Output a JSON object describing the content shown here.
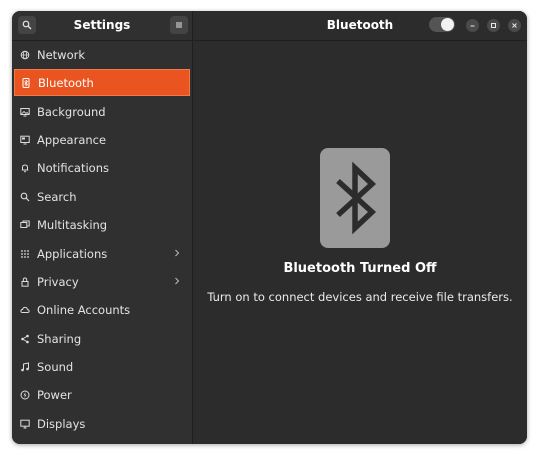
{
  "sidebar": {
    "title": "Settings",
    "items": [
      {
        "label": "Network",
        "icon": "network-icon"
      },
      {
        "label": "Bluetooth",
        "icon": "bluetooth-icon",
        "selected": true
      },
      {
        "label": "Background",
        "icon": "background-icon"
      },
      {
        "label": "Appearance",
        "icon": "appearance-icon"
      },
      {
        "label": "Notifications",
        "icon": "bell-icon"
      },
      {
        "label": "Search",
        "icon": "search-icon"
      },
      {
        "label": "Multitasking",
        "icon": "multitasking-icon"
      },
      {
        "label": "Applications",
        "icon": "applications-icon",
        "has_arrow": true
      },
      {
        "label": "Privacy",
        "icon": "lock-icon",
        "has_arrow": true
      },
      {
        "label": "Online Accounts",
        "icon": "cloud-icon"
      },
      {
        "label": "Sharing",
        "icon": "sharing-icon"
      },
      {
        "label": "Sound",
        "icon": "music-note-icon"
      },
      {
        "label": "Power",
        "icon": "power-icon"
      },
      {
        "label": "Displays",
        "icon": "display-icon"
      }
    ]
  },
  "header": {
    "title": "Bluetooth",
    "toggle_on": false
  },
  "main": {
    "status_title": "Bluetooth Turned Off",
    "status_description": "Turn on to connect devices and receive file transfers."
  },
  "colors": {
    "accent": "#e95420",
    "window_bg": "#2b2b2b",
    "sidebar_bg": "#303030"
  }
}
